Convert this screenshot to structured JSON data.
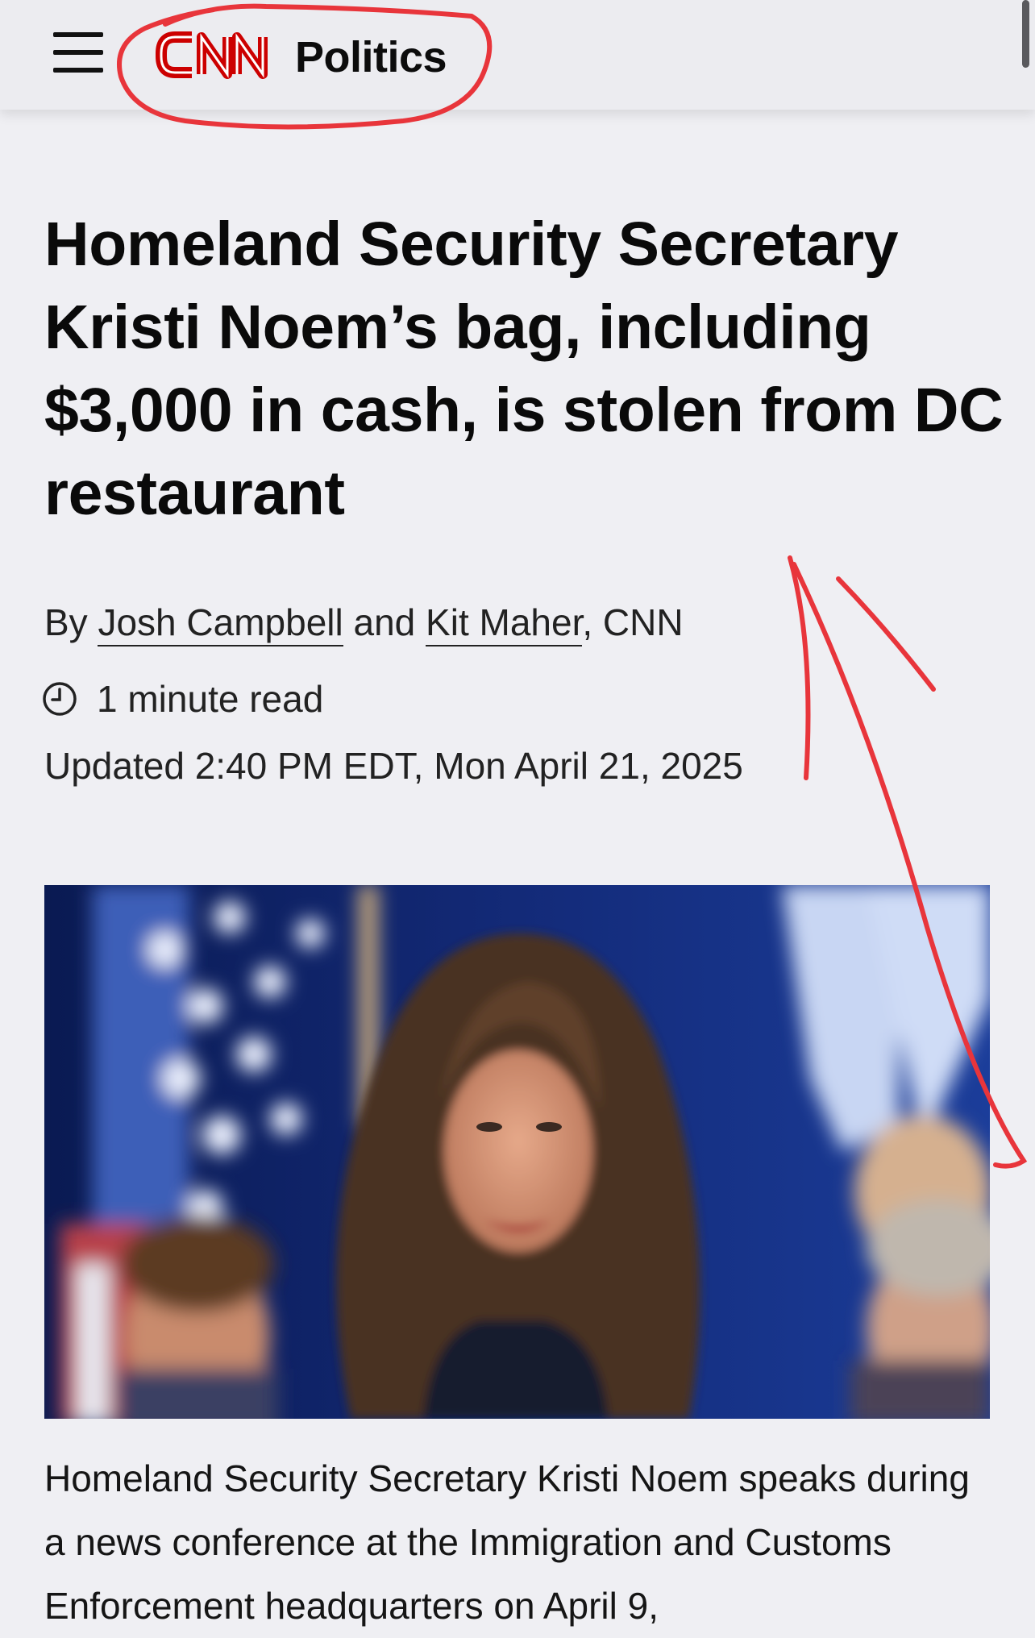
{
  "header": {
    "menu_icon": "hamburger-menu-icon",
    "logo_text": "CNN",
    "section": "Politics"
  },
  "article": {
    "headline": "Homeland Security Secretary Kristi Noem’s bag, including $3,000 in cash, is stolen from DC restaurant",
    "byline": {
      "prefix": "By ",
      "author1": "Josh Campbell",
      "joiner": " and ",
      "author2": "Kit Maher",
      "suffix": ", CNN"
    },
    "read_time": "1 minute read",
    "read_time_icon": "clock-icon",
    "updated": "Updated 2:40 PM EDT, Mon April 21, 2025",
    "caption": "Homeland Security Secretary Kristi Noem speaks during a news conference at the Immigration and Customs Enforcement headquarters on April 9,"
  },
  "colors": {
    "cnn_red": "#cc0000",
    "annotation_red": "#e8353b",
    "background": "#efeff3"
  }
}
